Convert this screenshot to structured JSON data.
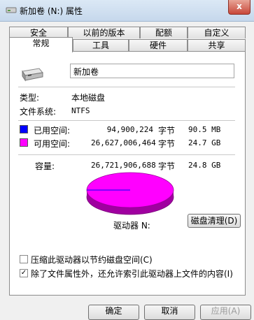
{
  "window": {
    "title": "新加卷 (N:) 属性",
    "close_glyph": "x"
  },
  "tabs_row1": [
    "安全",
    "以前的版本",
    "配额",
    "自定义"
  ],
  "tabs_row2": [
    "常规",
    "工具",
    "硬件",
    "共享"
  ],
  "drive": {
    "name": "新加卷",
    "type_label": "类型:",
    "type_value": "本地磁盘",
    "fs_label": "文件系统:",
    "fs_value": "NTFS"
  },
  "space": {
    "used_label": "已用空间:",
    "used_bytes": "94,900,224",
    "used_unit": "字节",
    "used_human": "90.5 MB",
    "used_color": "#0000ff",
    "free_label": "可用空间:",
    "free_bytes": "26,627,006,464",
    "free_unit": "字节",
    "free_human": "24.7 GB",
    "free_color": "#ff00ff",
    "capacity_label": "容量:",
    "capacity_bytes": "26,721,906,688",
    "capacity_unit": "字节",
    "capacity_human": "24.8 GB"
  },
  "drive_label": "驱动器 N:",
  "cleanup_button": "磁盘清理(D)",
  "options": {
    "compress_label": "压缩此驱动器以节约磁盘空间(C)",
    "compress_checked": false,
    "index_label": "除了文件属性外，还允许索引此驱动器上文件的内容(I)",
    "index_checked": true,
    "check_glyph": "✓"
  },
  "footer": {
    "ok": "确定",
    "cancel": "取消",
    "apply": "应用(A)"
  }
}
